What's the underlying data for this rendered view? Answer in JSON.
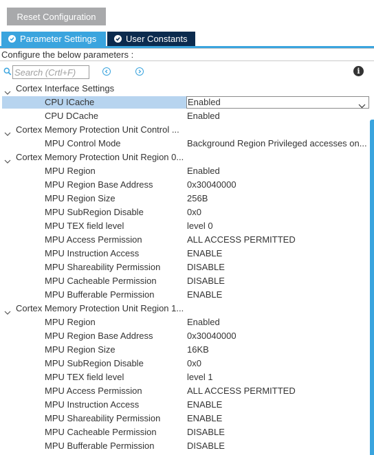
{
  "toolbar": {
    "reset_label": "Reset Configuration"
  },
  "tabs": [
    {
      "label": "Parameter Settings",
      "active": true
    },
    {
      "label": "User Constants",
      "active": false
    }
  ],
  "configure_text": "Configure the below parameters :",
  "search": {
    "placeholder": "Search (Crtl+F)"
  },
  "colors": {
    "accent": "#3aa4de",
    "dark_tab": "#0c2b4e",
    "selection": "#b7d4ef",
    "button_gray": "#a8a9ab"
  },
  "icons": {
    "search": "search-icon",
    "prev": "chevron-left-circle-icon",
    "next": "chevron-right-circle-icon",
    "info": "info-icon",
    "expand": "chevron-down-icon",
    "tab_check": "check-circle-icon"
  },
  "groups": [
    {
      "label": "Cortex Interface Settings",
      "params": [
        {
          "label": "CPU ICache",
          "value": "Enabled",
          "selected": true,
          "dropdown": true
        },
        {
          "label": "CPU DCache",
          "value": "Enabled"
        }
      ]
    },
    {
      "label": "Cortex Memory Protection Unit Control ...",
      "params": [
        {
          "label": "MPU Control Mode",
          "value": "Background Region Privileged accesses on..."
        }
      ]
    },
    {
      "label": "Cortex Memory Protection Unit Region 0...",
      "params": [
        {
          "label": "MPU Region",
          "value": "Enabled"
        },
        {
          "label": "MPU Region Base Address",
          "value": "0x30040000"
        },
        {
          "label": "MPU Region Size",
          "value": "256B"
        },
        {
          "label": "MPU SubRegion Disable",
          "value": "0x0"
        },
        {
          "label": "MPU TEX field level",
          "value": "level 0"
        },
        {
          "label": "MPU Access Permission",
          "value": "ALL ACCESS PERMITTED"
        },
        {
          "label": "MPU Instruction Access",
          "value": "ENABLE"
        },
        {
          "label": "MPU Shareability Permission",
          "value": "DISABLE"
        },
        {
          "label": "MPU Cacheable Permission",
          "value": "DISABLE"
        },
        {
          "label": "MPU Bufferable  Permission",
          "value": "ENABLE"
        }
      ]
    },
    {
      "label": "Cortex Memory Protection Unit Region 1...",
      "params": [
        {
          "label": "MPU Region",
          "value": "Enabled"
        },
        {
          "label": "MPU Region Base Address",
          "value": "0x30040000"
        },
        {
          "label": "MPU Region Size",
          "value": "16KB"
        },
        {
          "label": "MPU SubRegion Disable",
          "value": "0x0"
        },
        {
          "label": "MPU TEX field level",
          "value": "level 1"
        },
        {
          "label": "MPU Access Permission",
          "value": "ALL ACCESS PERMITTED"
        },
        {
          "label": "MPU Instruction Access",
          "value": "ENABLE"
        },
        {
          "label": "MPU Shareability Permission",
          "value": "ENABLE"
        },
        {
          "label": "MPU Cacheable Permission",
          "value": "DISABLE"
        },
        {
          "label": "MPU Bufferable  Permission",
          "value": "DISABLE"
        }
      ]
    }
  ]
}
